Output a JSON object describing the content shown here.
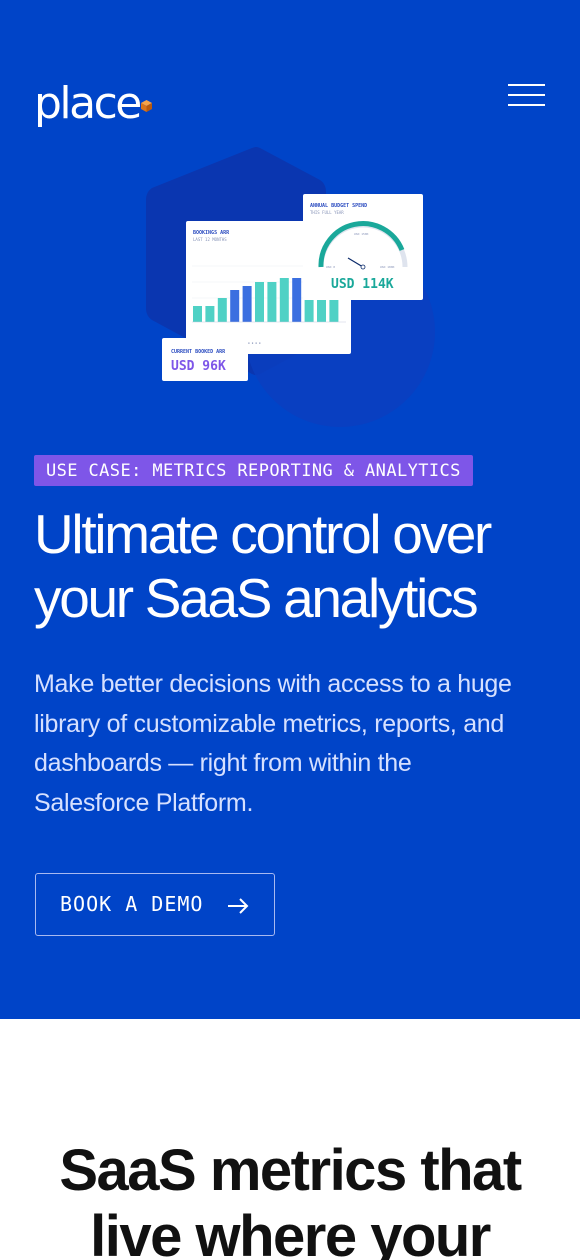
{
  "header": {
    "logo_text": "place",
    "brand_accent": "#f08a24",
    "menu_icon": "hamburger-menu-icon"
  },
  "hero": {
    "background": "#0044c8",
    "badge_label": "USE CASE: METRICS REPORTING & ANALYTICS",
    "badge_color": "#7e56e8",
    "headline_line1": "Ultimate control over",
    "headline_line2": "your SaaS analytics",
    "description_line1": "Make better decisions with access to a huge",
    "description_line2": "library of customizable metrics, reports, and",
    "description_line3": "dashboards — right from within the",
    "description_line4": "Salesforce Platform.",
    "cta_label": "BOOK A DEMO",
    "cta_icon": "arrow-right-icon"
  },
  "illustration": {
    "bookings_card": {
      "title": "BOOKINGS ARR",
      "subtitle": "LAST 12 MONTHS",
      "bar_values": [
        2,
        2,
        3,
        4,
        4.5,
        5,
        5,
        5.5,
        5.5,
        5,
        4.5,
        4.5
      ],
      "bar_color": "#4fd1c5",
      "accent_color": "#3b6fe0"
    },
    "budget_card": {
      "title": "ANNUAL BUDGET SPEND",
      "subtitle": "THIS FULL YEAR",
      "value": "USD 114K",
      "gauge_min": "USD 0",
      "gauge_max": "USD 180K",
      "gauge_mid": "USD 150K",
      "value_color": "#1aa89a"
    },
    "arr_card": {
      "title": "CURRENT BOOKED ARR",
      "value": "USD 96K",
      "value_color": "#7e56e8"
    }
  },
  "section": {
    "title_line1": "SaaS metrics that",
    "title_line2": "live where your"
  }
}
